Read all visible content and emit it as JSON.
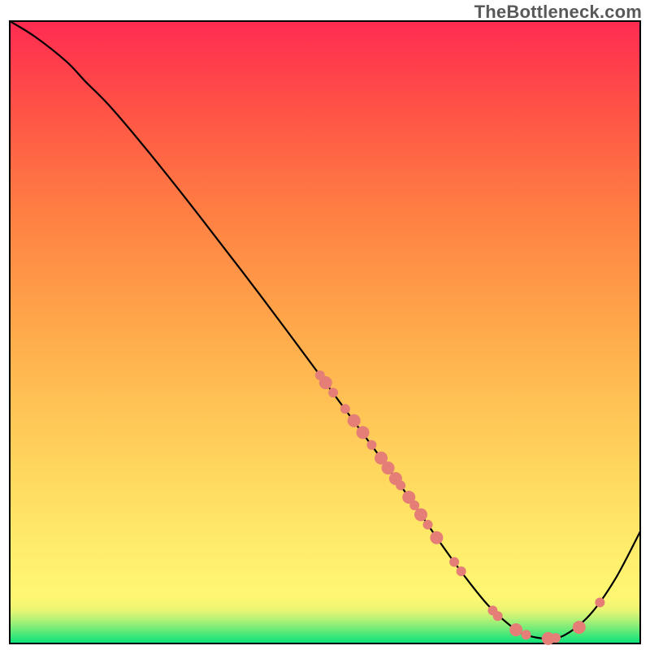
{
  "watermark": "TheBottleneck.com",
  "chart_data": {
    "type": "line",
    "title": "",
    "xlabel": "",
    "ylabel": "",
    "xlim": [
      0,
      100
    ],
    "ylim": [
      0,
      100
    ],
    "gradient_stops": [
      {
        "offset": 0.0,
        "color": "#06e27a"
      },
      {
        "offset": 0.012,
        "color": "#3ce779"
      },
      {
        "offset": 0.025,
        "color": "#78ec78"
      },
      {
        "offset": 0.04,
        "color": "#b9f276"
      },
      {
        "offset": 0.055,
        "color": "#ecf674"
      },
      {
        "offset": 0.075,
        "color": "#fff772"
      },
      {
        "offset": 0.1,
        "color": "#fff470"
      },
      {
        "offset": 0.15,
        "color": "#ffed6b"
      },
      {
        "offset": 0.25,
        "color": "#ffdc60"
      },
      {
        "offset": 0.4,
        "color": "#ffbf53"
      },
      {
        "offset": 0.55,
        "color": "#ff9f48"
      },
      {
        "offset": 0.7,
        "color": "#ff7d43"
      },
      {
        "offset": 0.85,
        "color": "#ff5546"
      },
      {
        "offset": 1.0,
        "color": "#ff2b51"
      }
    ],
    "series": [
      {
        "name": "bottleneck-curve",
        "color": "#000000",
        "x": [
          0,
          4,
          9,
          12,
          16,
          22,
          30,
          40,
          50,
          58,
          64,
          68,
          72,
          76,
          80,
          82,
          85,
          88,
          92,
          96,
          100
        ],
        "y": [
          100,
          97.5,
          93.5,
          90.3,
          86.2,
          79,
          68.8,
          55.6,
          42,
          31,
          22.5,
          16.6,
          11.0,
          6.0,
          2.4,
          1.35,
          0.8,
          1.35,
          4.6,
          10.3,
          18.0
        ]
      }
    ],
    "points": {
      "color": "#e47e76",
      "radius_small": 6,
      "radius_large": 8,
      "data": [
        {
          "x": 49.2,
          "y": 43.1,
          "r": "s"
        },
        {
          "x": 50.1,
          "y": 41.9,
          "r": "l"
        },
        {
          "x": 51.3,
          "y": 40.3,
          "r": "s"
        },
        {
          "x": 53.2,
          "y": 37.7,
          "r": "s"
        },
        {
          "x": 54.6,
          "y": 35.8,
          "r": "l"
        },
        {
          "x": 56.0,
          "y": 33.9,
          "r": "l"
        },
        {
          "x": 57.4,
          "y": 31.9,
          "r": "s"
        },
        {
          "x": 58.9,
          "y": 29.8,
          "r": "l"
        },
        {
          "x": 60.0,
          "y": 28.2,
          "r": "l"
        },
        {
          "x": 61.2,
          "y": 26.5,
          "r": "l"
        },
        {
          "x": 62.0,
          "y": 25.4,
          "r": "s"
        },
        {
          "x": 63.3,
          "y": 23.5,
          "r": "l"
        },
        {
          "x": 64.2,
          "y": 22.2,
          "r": "s"
        },
        {
          "x": 65.2,
          "y": 20.7,
          "r": "l"
        },
        {
          "x": 66.3,
          "y": 19.1,
          "r": "s"
        },
        {
          "x": 67.7,
          "y": 17.0,
          "r": "l"
        },
        {
          "x": 70.5,
          "y": 13.1,
          "r": "s"
        },
        {
          "x": 71.6,
          "y": 11.6,
          "r": "s"
        },
        {
          "x": 76.6,
          "y": 5.3,
          "r": "s"
        },
        {
          "x": 77.4,
          "y": 4.4,
          "r": "s"
        },
        {
          "x": 80.3,
          "y": 2.2,
          "r": "l"
        },
        {
          "x": 81.9,
          "y": 1.4,
          "r": "s"
        },
        {
          "x": 85.4,
          "y": 0.8,
          "r": "l"
        },
        {
          "x": 86.6,
          "y": 0.9,
          "r": "s"
        },
        {
          "x": 90.3,
          "y": 2.6,
          "r": "l"
        },
        {
          "x": 93.6,
          "y": 6.6,
          "r": "s"
        }
      ]
    }
  }
}
